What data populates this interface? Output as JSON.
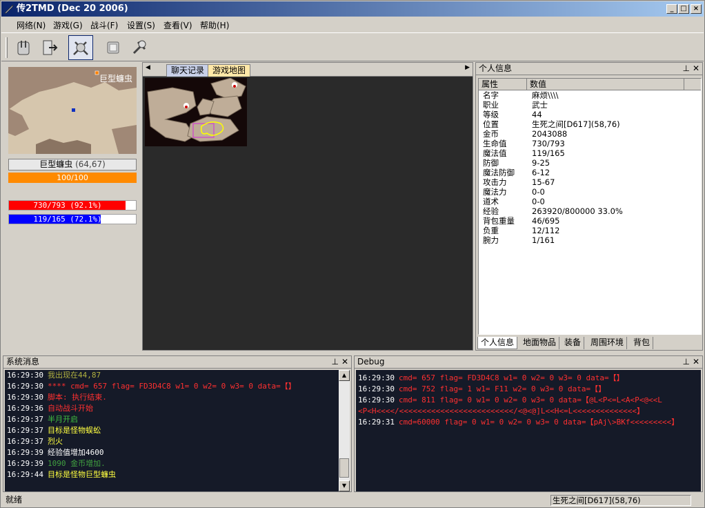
{
  "window": {
    "title": "传2TMD (Dec 20 2006)"
  },
  "menu": [
    "网络(N)",
    "游戏(G)",
    "战斗(F)",
    "设置(S)",
    "查看(V)",
    "帮助(H)"
  ],
  "toolbar": [
    "connect-icon",
    "exit-icon",
    "battle-icon",
    "settings-icon",
    "tools-icon"
  ],
  "target": {
    "map_label": "巨型蠊虫",
    "name": "巨型蠊虫",
    "pos": "(64,67)",
    "hp_text": "100/100",
    "hp_fraction": 1.0
  },
  "player": {
    "hp_text": "730/793  (92.1%)",
    "hp_fraction": 0.921,
    "mp_text": "119/165  (72.1%)",
    "mp_fraction": 0.721
  },
  "center_tabs": [
    "聊天记录",
    "游戏地图"
  ],
  "right_panel": {
    "title": "个人信息",
    "headers": [
      "属性",
      "数值"
    ],
    "rows": [
      [
        "名字",
        "麻烦\\\\\\\\"
      ],
      [
        "职业",
        "武士"
      ],
      [
        "等级",
        "44"
      ],
      [
        "位置",
        "生死之间[D617](58,76)"
      ],
      [
        "金币",
        "2043088"
      ],
      [
        "生命值",
        "730/793"
      ],
      [
        "魔法值",
        "119/165"
      ],
      [
        "防御",
        "9-25"
      ],
      [
        "魔法防御",
        "6-12"
      ],
      [
        "攻击力",
        "15-67"
      ],
      [
        "魔法力",
        "0-0"
      ],
      [
        "道术",
        "0-0"
      ],
      [
        "经验",
        "263920/800000 33.0%"
      ],
      [
        "背包重量",
        "46/695"
      ],
      [
        "负重",
        "12/112"
      ],
      [
        "腕力",
        "1/161"
      ]
    ],
    "tabs": [
      "个人信息",
      "地面物品",
      "装备",
      "周围环境",
      "背包"
    ]
  },
  "system_log": {
    "title": "系统消息",
    "lines": [
      {
        "t": "16:29:30",
        "msg": "我出现在44,87",
        "color": "#b0b040"
      },
      {
        "t": "16:29:30",
        "msg": "**** cmd=  657 flag= FD3D4C8 w1=   0 w2=   0 w3=   0 data=【】",
        "color": "#ff3030"
      },
      {
        "t": "16:29:30",
        "msg": "脚本: 执行结束.",
        "color": "#ff3030"
      },
      {
        "t": "16:29:36",
        "msg": "自动战斗开始",
        "color": "#ff3030"
      },
      {
        "t": "16:29:37",
        "msg": "半月开启",
        "color": "#40c040"
      },
      {
        "t": "16:29:37",
        "msg": "目标是怪物蜈蚣",
        "color": "#ffff40"
      },
      {
        "t": "16:29:37",
        "msg": "烈火",
        "color": "#ffff40"
      },
      {
        "t": "16:29:39",
        "msg": "经验值增加4600",
        "color": "#ffffff"
      },
      {
        "t": "16:29:39",
        "msg": "1090 金币增加.",
        "color": "#40a040"
      },
      {
        "t": "16:29:44",
        "msg": "目标是怪物巨型蠊虫",
        "color": "#ffff40"
      }
    ]
  },
  "debug_log": {
    "title": "Debug",
    "lines": [
      {
        "t": "16:29:30",
        "msg": "cmd=  657 flag= FD3D4C8 w1=   0 w2=   0 w3=   0 data=【】"
      },
      {
        "t": "16:29:30",
        "msg": "cmd=  752 flag=       1 w1= F11 w2=   0 w3=   0 data=【】"
      },
      {
        "t": "16:29:30",
        "msg": "cmd=  811 flag=       0 w1=   0 w2=   0 w3=   0 data=【@L<P<=L<A<P<@<<L"
      },
      {
        "t": "",
        "msg": "<P<H<<<</<<<<<<<<<<<<<<<<<<<<<<<<</<@<@]L<<H<=L<<<<<<<<<<<<<<】"
      },
      {
        "t": "16:29:31",
        "msg": "cmd=60000 flag=       0 w1=   0 w2=   0 w3=   0 data=【pAj\\>BKf<<<<<<<<<】"
      }
    ]
  },
  "status": {
    "left": "就绪",
    "right": "生死之间[D617](58,76)"
  }
}
